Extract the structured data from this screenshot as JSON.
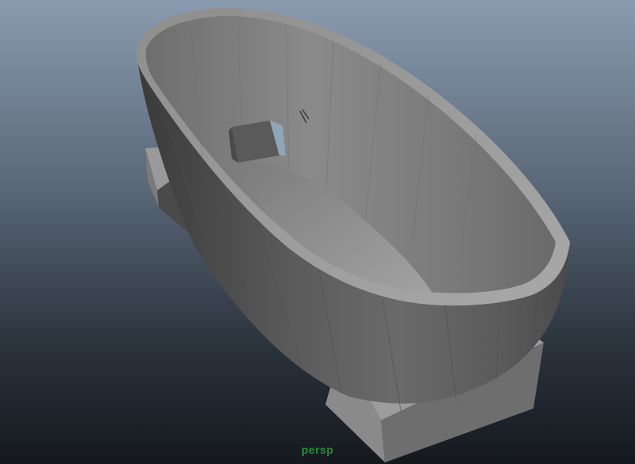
{
  "viewport": {
    "camera_label": "persp",
    "label_color": "#2a8a3a"
  },
  "model": {
    "object": "bathtub-mesh",
    "shading_color": "#6b6b6b"
  }
}
